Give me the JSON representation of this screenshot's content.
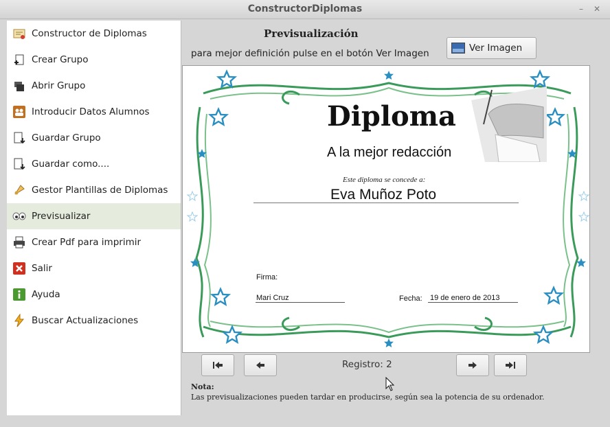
{
  "window": {
    "title": "ConstructorDiplomas"
  },
  "sidebar": {
    "items": [
      {
        "label": "Constructor de Diplomas",
        "icon": "diploma-icon"
      },
      {
        "label": "Crear Grupo",
        "icon": "new-group-icon"
      },
      {
        "label": "Abrir Grupo",
        "icon": "open-group-icon"
      },
      {
        "label": "Introducir Datos Alumnos",
        "icon": "students-icon"
      },
      {
        "label": "Guardar Grupo",
        "icon": "save-icon"
      },
      {
        "label": "Guardar como....",
        "icon": "save-as-icon"
      },
      {
        "label": "Gestor Plantillas de Diplomas",
        "icon": "templates-icon"
      },
      {
        "label": "Previsualizar",
        "icon": "preview-eyes-icon",
        "selected": true
      },
      {
        "label": "Crear Pdf para imprimir",
        "icon": "printer-icon"
      },
      {
        "label": "Salir",
        "icon": "exit-icon"
      },
      {
        "label": "Ayuda",
        "icon": "help-icon"
      },
      {
        "label": "Buscar Actualizaciones",
        "icon": "update-icon"
      }
    ]
  },
  "main": {
    "heading": "Previsualización",
    "hint": "para mejor definición pulse en el botón Ver Imagen",
    "view_image_label": "Ver Imagen",
    "registro_label": "Registro: 2",
    "note_title": "Nota:",
    "note_text": "Las previsualizaciones pueden tardar en producirse, según sea la potencia de su ordenador."
  },
  "diploma": {
    "title": "Diploma",
    "subtitle": "A la mejor redacción",
    "granted_text": "Este diploma se concede a:",
    "recipient": "Eva Muñoz Poto",
    "signature_label": "Firma:",
    "signer": "Mari Cruz",
    "date_label": "Fecha:",
    "date": "19 de enero de 2013"
  },
  "colors": {
    "border_green": "#3a9a5a",
    "star_blue": "#2a8fc0",
    "selected_row": "#e6ecdd"
  }
}
